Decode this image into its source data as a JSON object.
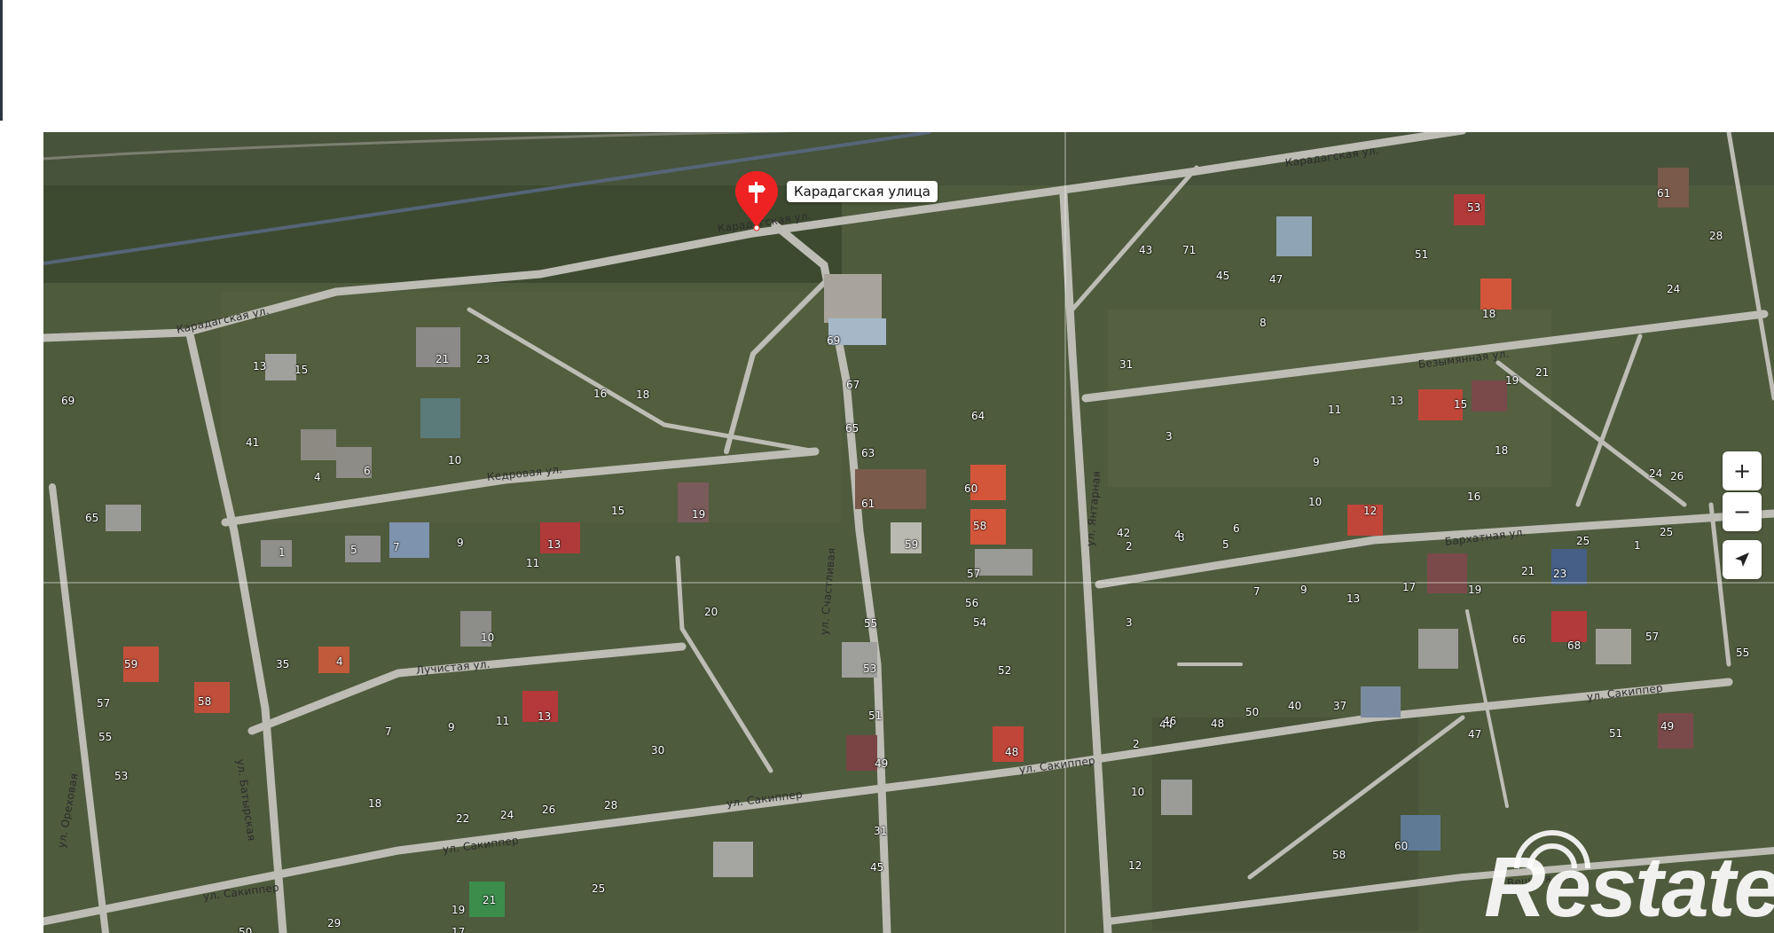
{
  "map": {
    "pin_label": "Карадагская улица",
    "zoom_in_label": "+",
    "zoom_out_label": "−",
    "watermark_text": "Restate",
    "street_labels": [
      "Карадагская ул.",
      "Карадагская ул.",
      "Карадагская ул.",
      "Кедровая ул.",
      "Лучистая ул.",
      "ул. Сакиппер",
      "ул. Сакиппер",
      "ул. Сакиппер",
      "ул. Сакиппер",
      "ул. Сакиппер",
      "Безымянная ул.",
      "Бархатная ул.",
      "Вешняя ул.",
      "ул. Батырская",
      "ул. Ореховая",
      "ул. Счастливая",
      "ул. Янтарная"
    ],
    "house_numbers": [
      "69",
      "13",
      "15",
      "21",
      "23",
      "16",
      "18",
      "41",
      "4",
      "6",
      "10",
      "65",
      "1",
      "5",
      "7",
      "9",
      "11",
      "13",
      "15",
      "19",
      "59",
      "57",
      "58",
      "55",
      "53",
      "35",
      "4",
      "10",
      "20",
      "7",
      "9",
      "11",
      "13",
      "30",
      "18",
      "22",
      "24",
      "26",
      "28",
      "25",
      "29",
      "21",
      "19",
      "17",
      "50",
      "69",
      "67",
      "65",
      "63",
      "61",
      "59",
      "60",
      "58",
      "57",
      "56",
      "55",
      "54",
      "53",
      "52",
      "51",
      "49",
      "48",
      "64",
      "31",
      "45",
      "43",
      "71",
      "45",
      "47",
      "8",
      "53",
      "51",
      "18",
      "61",
      "24",
      "28",
      "31",
      "3",
      "9",
      "11",
      "13",
      "15",
      "18",
      "19",
      "21",
      "25",
      "26",
      "24",
      "16",
      "12",
      "10",
      "6",
      "8",
      "2",
      "4",
      "5",
      "7",
      "9",
      "13",
      "17",
      "19",
      "21",
      "23",
      "25",
      "1",
      "3",
      "42",
      "44",
      "46",
      "48",
      "50",
      "40",
      "37",
      "2",
      "10",
      "12",
      "58",
      "60",
      "66",
      "68",
      "57",
      "55",
      "49",
      "51",
      "47"
    ],
    "colors": {
      "road": "#bdbdb5",
      "grass": "#4d5a3c",
      "pin": "#ee2222"
    }
  }
}
